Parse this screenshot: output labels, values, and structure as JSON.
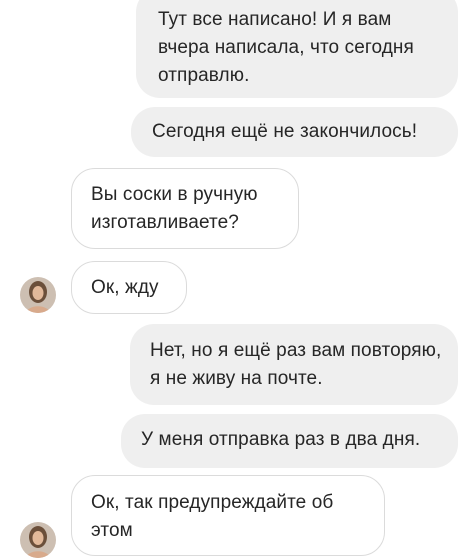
{
  "messages": [
    {
      "direction": "outgoing",
      "text": "Тут все написано! И я вам вчера написала, что сегодня отправлю."
    },
    {
      "direction": "outgoing",
      "text": "Сегодня ещё не закончилось!"
    },
    {
      "direction": "incoming",
      "text": "Вы соски в ручную изготавливаете?"
    },
    {
      "direction": "incoming",
      "text": "Ок, жду",
      "avatar": "user-avatar-photo"
    },
    {
      "direction": "outgoing",
      "text": "Нет, но я ещё раз вам повторяю, я не живу на почте."
    },
    {
      "direction": "outgoing",
      "text": "У меня отправка раз в два дня."
    },
    {
      "direction": "incoming",
      "text": "Ок, так предупреждайте об этом",
      "avatar": "user-avatar-photo"
    }
  ],
  "colors": {
    "outgoing_bubble": "#efefef",
    "incoming_border": "#dbdbdb",
    "text": "#262626"
  }
}
